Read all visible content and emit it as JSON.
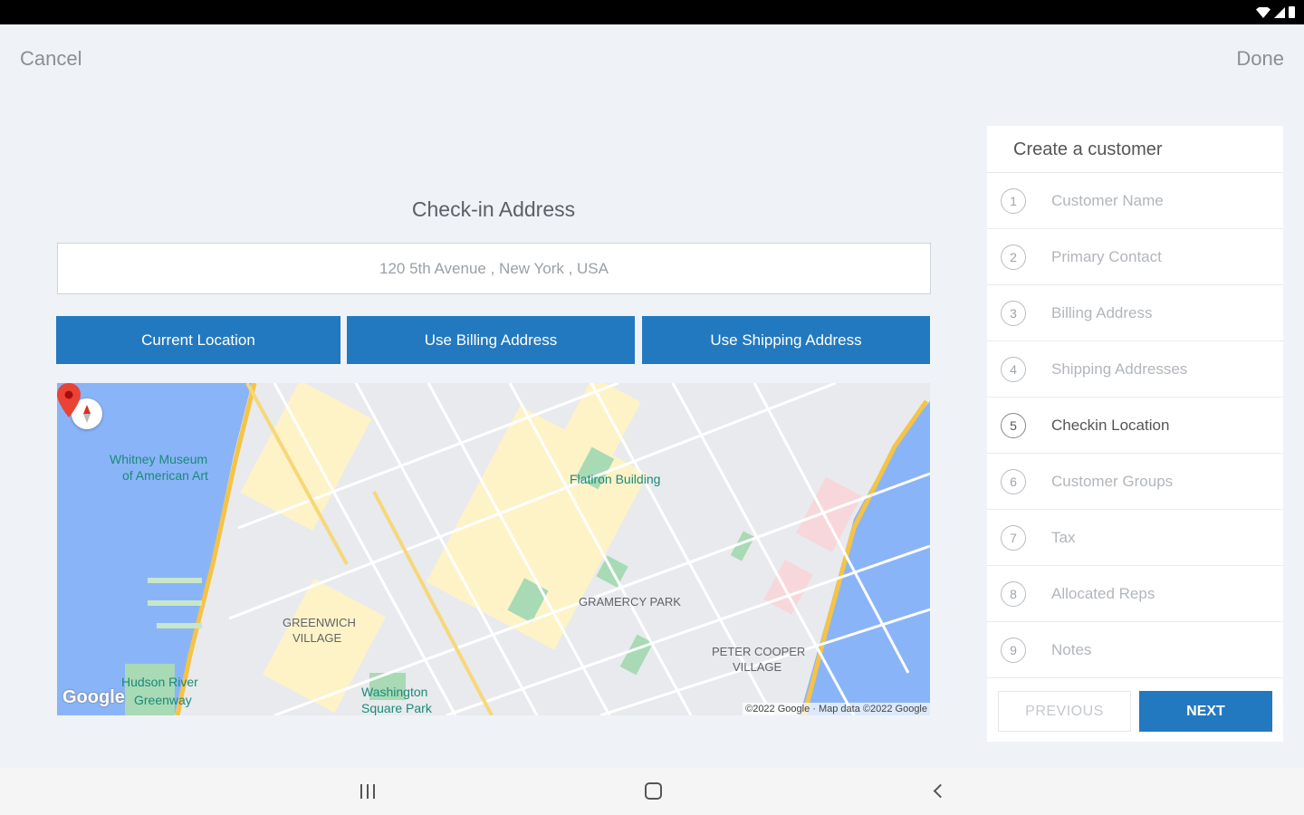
{
  "header": {
    "cancel_label": "Cancel",
    "done_label": "Done"
  },
  "checkin": {
    "title": "Check-in Address",
    "address_value": "120 5th Avenue , New York , USA",
    "buttons": {
      "current_location": "Current Location",
      "use_billing": "Use Billing Address",
      "use_shipping": "Use Shipping Address"
    }
  },
  "map": {
    "labels": {
      "whitney": "Whitney Museum",
      "whitney2": "of American Art",
      "flatiron": "Flatiron Building",
      "gramercy": "GRAMERCY PARK",
      "greenwich": "GREENWICH",
      "greenwich2": "VILLAGE",
      "peter_cooper": "PETER COOPER",
      "peter_cooper2": "VILLAGE",
      "washington": "Washington",
      "washington2": "Square Park",
      "hudson": "Hudson River",
      "hudson2": "Greenway"
    },
    "logo": "Google",
    "copyright": "©2022 Google · Map data ©2022 Google"
  },
  "wizard": {
    "title": "Create a customer",
    "steps": [
      {
        "num": "1",
        "label": "Customer Name"
      },
      {
        "num": "2",
        "label": "Primary Contact"
      },
      {
        "num": "3",
        "label": "Billing Address"
      },
      {
        "num": "4",
        "label": "Shipping Addresses"
      },
      {
        "num": "5",
        "label": "Checkin Location"
      },
      {
        "num": "6",
        "label": "Customer Groups"
      },
      {
        "num": "7",
        "label": "Tax"
      },
      {
        "num": "8",
        "label": "Allocated Reps"
      },
      {
        "num": "9",
        "label": "Notes"
      }
    ],
    "active_step": 5,
    "previous_label": "PREVIOUS",
    "next_label": "NEXT"
  },
  "colors": {
    "accent": "#2379bf",
    "background": "#eff3f7"
  },
  "icons": [
    "wifi-icon",
    "signal-icon",
    "battery-icon",
    "compass-icon",
    "map-pin-icon",
    "recents-icon",
    "home-icon",
    "back-icon"
  ]
}
